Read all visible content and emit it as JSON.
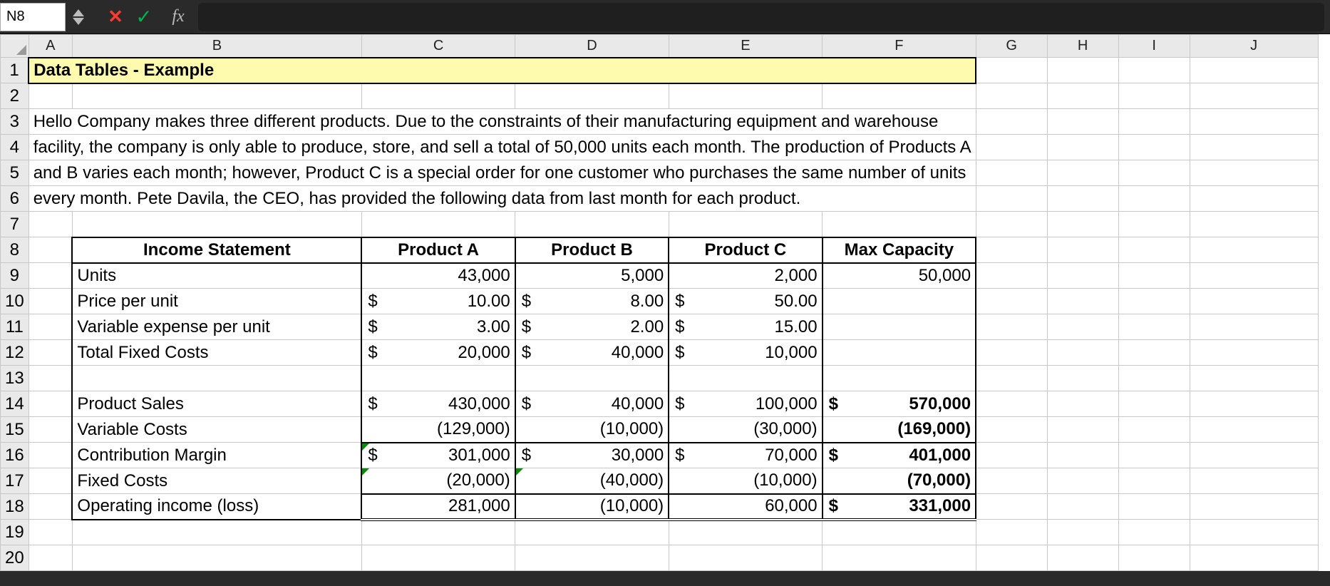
{
  "formula_bar": {
    "cell_ref": "N8",
    "fx_label": "fx"
  },
  "columns": [
    "A",
    "B",
    "C",
    "D",
    "E",
    "F",
    "G",
    "H",
    "I",
    "J"
  ],
  "rows": [
    "1",
    "2",
    "3",
    "4",
    "5",
    "6",
    "7",
    "8",
    "9",
    "10",
    "11",
    "12",
    "13",
    "14",
    "15",
    "16",
    "17",
    "18",
    "19",
    "20"
  ],
  "title": "Data Tables - Example",
  "paragraph": {
    "l1": "Hello Company makes three different products.  Due to the constraints of their manufacturing equipment and warehouse",
    "l2": "facility, the company is only able to produce, store, and sell a total of 50,000 units each month.  The production of Products A",
    "l3": "and B varies each month; however, Product C is a special order for one customer who purchases the same number of units",
    "l4": "every month.  Pete Davila, the CEO, has provided the following data from last month for each product."
  },
  "headers": {
    "income_statement": "Income Statement",
    "product_a": "Product A",
    "product_b": "Product B",
    "product_c": "Product C",
    "max_capacity": "Max Capacity"
  },
  "rows_labels": {
    "units": "Units",
    "price_per_unit": "Price per unit",
    "variable_expense_per_unit": "Variable expense per unit",
    "total_fixed_costs": "Total Fixed Costs",
    "product_sales": "Product Sales",
    "variable_costs": "Variable Costs",
    "contribution_margin": "Contribution Margin",
    "fixed_costs": "Fixed Costs",
    "operating_income": "Operating income (loss)"
  },
  "vals": {
    "units": {
      "a": "43,000",
      "b": "5,000",
      "c": "2,000",
      "max": "50,000"
    },
    "price": {
      "a": "10.00",
      "b": "8.00",
      "c": "50.00"
    },
    "varexp": {
      "a": "3.00",
      "b": "2.00",
      "c": "15.00"
    },
    "fixed": {
      "a": "20,000",
      "b": "40,000",
      "c": "10,000"
    },
    "sales": {
      "a": "430,000",
      "b": "40,000",
      "c": "100,000",
      "f": "570,000"
    },
    "varcosts": {
      "a": "(129,000)",
      "b": "(10,000)",
      "c": "(30,000)",
      "f": "(169,000)"
    },
    "contrib": {
      "a": "301,000",
      "b": "30,000",
      "c": "70,000",
      "f": "401,000"
    },
    "fixedc": {
      "a": "(20,000)",
      "b": "(40,000)",
      "c": "(10,000)",
      "f": "(70,000)"
    },
    "opinc": {
      "a": "281,000",
      "b": "(10,000)",
      "c": "60,000",
      "f": "331,000"
    }
  },
  "chart_data": {
    "type": "table",
    "title": "Income Statement",
    "columns": [
      "Product A",
      "Product B",
      "Product C",
      "Max Capacity"
    ],
    "rows": [
      {
        "label": "Units",
        "values": [
          43000,
          5000,
          2000,
          50000
        ]
      },
      {
        "label": "Price per unit",
        "values": [
          10.0,
          8.0,
          50.0,
          null
        ]
      },
      {
        "label": "Variable expense per unit",
        "values": [
          3.0,
          2.0,
          15.0,
          null
        ]
      },
      {
        "label": "Total Fixed Costs",
        "values": [
          20000,
          40000,
          10000,
          null
        ]
      },
      {
        "label": "Product Sales",
        "values": [
          430000,
          40000,
          100000,
          570000
        ]
      },
      {
        "label": "Variable Costs",
        "values": [
          -129000,
          -10000,
          -30000,
          -169000
        ]
      },
      {
        "label": "Contribution Margin",
        "values": [
          301000,
          30000,
          70000,
          401000
        ]
      },
      {
        "label": "Fixed Costs",
        "values": [
          -20000,
          -40000,
          -10000,
          -70000
        ]
      },
      {
        "label": "Operating income (loss)",
        "values": [
          281000,
          -10000,
          60000,
          331000
        ]
      }
    ]
  }
}
